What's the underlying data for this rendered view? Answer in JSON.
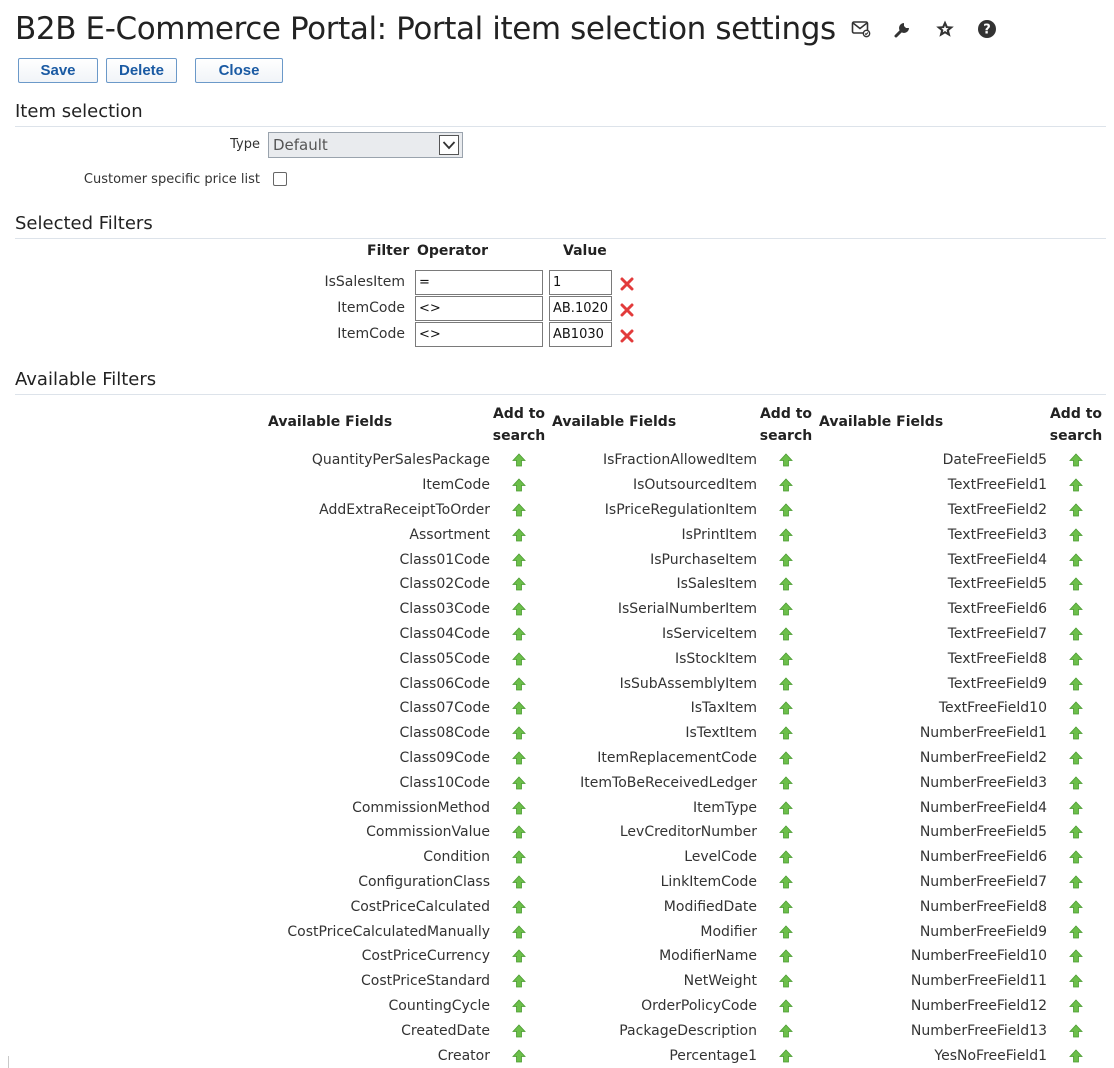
{
  "header": {
    "title": "B2B E-Commerce Portal: Portal item selection settings",
    "icons": [
      "mail-icon",
      "wrench-icon",
      "star-icon",
      "help-icon"
    ]
  },
  "toolbar": {
    "save_label": "Save",
    "delete_label": "Delete",
    "close_label": "Close"
  },
  "item_selection": {
    "heading": "Item selection",
    "type_label": "Type",
    "type_value": "Default",
    "customer_price_label": "Customer specific price list",
    "customer_price_checked": false
  },
  "selected_filters": {
    "heading": "Selected Filters",
    "columns": {
      "filter": "Filter",
      "operator": "Operator",
      "value": "Value"
    },
    "rows": [
      {
        "field": "IsSalesItem",
        "operator": "=",
        "value": "1"
      },
      {
        "field": "ItemCode",
        "operator": "<>",
        "value": "AB.1020"
      },
      {
        "field": "ItemCode",
        "operator": "<>",
        "value": "AB1030"
      }
    ]
  },
  "available_filters": {
    "heading": "Available Filters",
    "fields_header": "Available Fields",
    "add_header_line1": "Add to",
    "add_header_line2": "search",
    "columns": [
      [
        "QuantityPerSalesPackage",
        "ItemCode",
        "AddExtraReceiptToOrder",
        "Assortment",
        "Class01Code",
        "Class02Code",
        "Class03Code",
        "Class04Code",
        "Class05Code",
        "Class06Code",
        "Class07Code",
        "Class08Code",
        "Class09Code",
        "Class10Code",
        "CommissionMethod",
        "CommissionValue",
        "Condition",
        "ConfigurationClass",
        "CostPriceCalculated",
        "CostPriceCalculatedManually",
        "CostPriceCurrency",
        "CostPriceStandard",
        "CountingCycle",
        "CreatedDate",
        "Creator"
      ],
      [
        "IsFractionAllowedItem",
        "IsOutsourcedItem",
        "IsPriceRegulationItem",
        "IsPrintItem",
        "IsPurchaseItem",
        "IsSalesItem",
        "IsSerialNumberItem",
        "IsServiceItem",
        "IsStockItem",
        "IsSubAssemblyItem",
        "IsTaxItem",
        "IsTextItem",
        "ItemReplacementCode",
        "ItemToBeReceivedLedger",
        "ItemType",
        "LevCreditorNumber",
        "LevelCode",
        "LinkItemCode",
        "ModifiedDate",
        "Modifier",
        "ModifierName",
        "NetWeight",
        "OrderPolicyCode",
        "PackageDescription",
        "Percentage1"
      ],
      [
        "DateFreeField5",
        "TextFreeField1",
        "TextFreeField2",
        "TextFreeField3",
        "TextFreeField4",
        "TextFreeField5",
        "TextFreeField6",
        "TextFreeField7",
        "TextFreeField8",
        "TextFreeField9",
        "TextFreeField10",
        "NumberFreeField1",
        "NumberFreeField2",
        "NumberFreeField3",
        "NumberFreeField4",
        "NumberFreeField5",
        "NumberFreeField6",
        "NumberFreeField7",
        "NumberFreeField8",
        "NumberFreeField9",
        "NumberFreeField10",
        "NumberFreeField11",
        "NumberFreeField12",
        "NumberFreeField13",
        "YesNoFreeField1"
      ]
    ],
    "add_icon": "green-up-arrow-icon"
  },
  "colors": {
    "accent": "#1a5aa3",
    "delete": "#e23b3b",
    "add_arrow": "#6cbf4a"
  }
}
